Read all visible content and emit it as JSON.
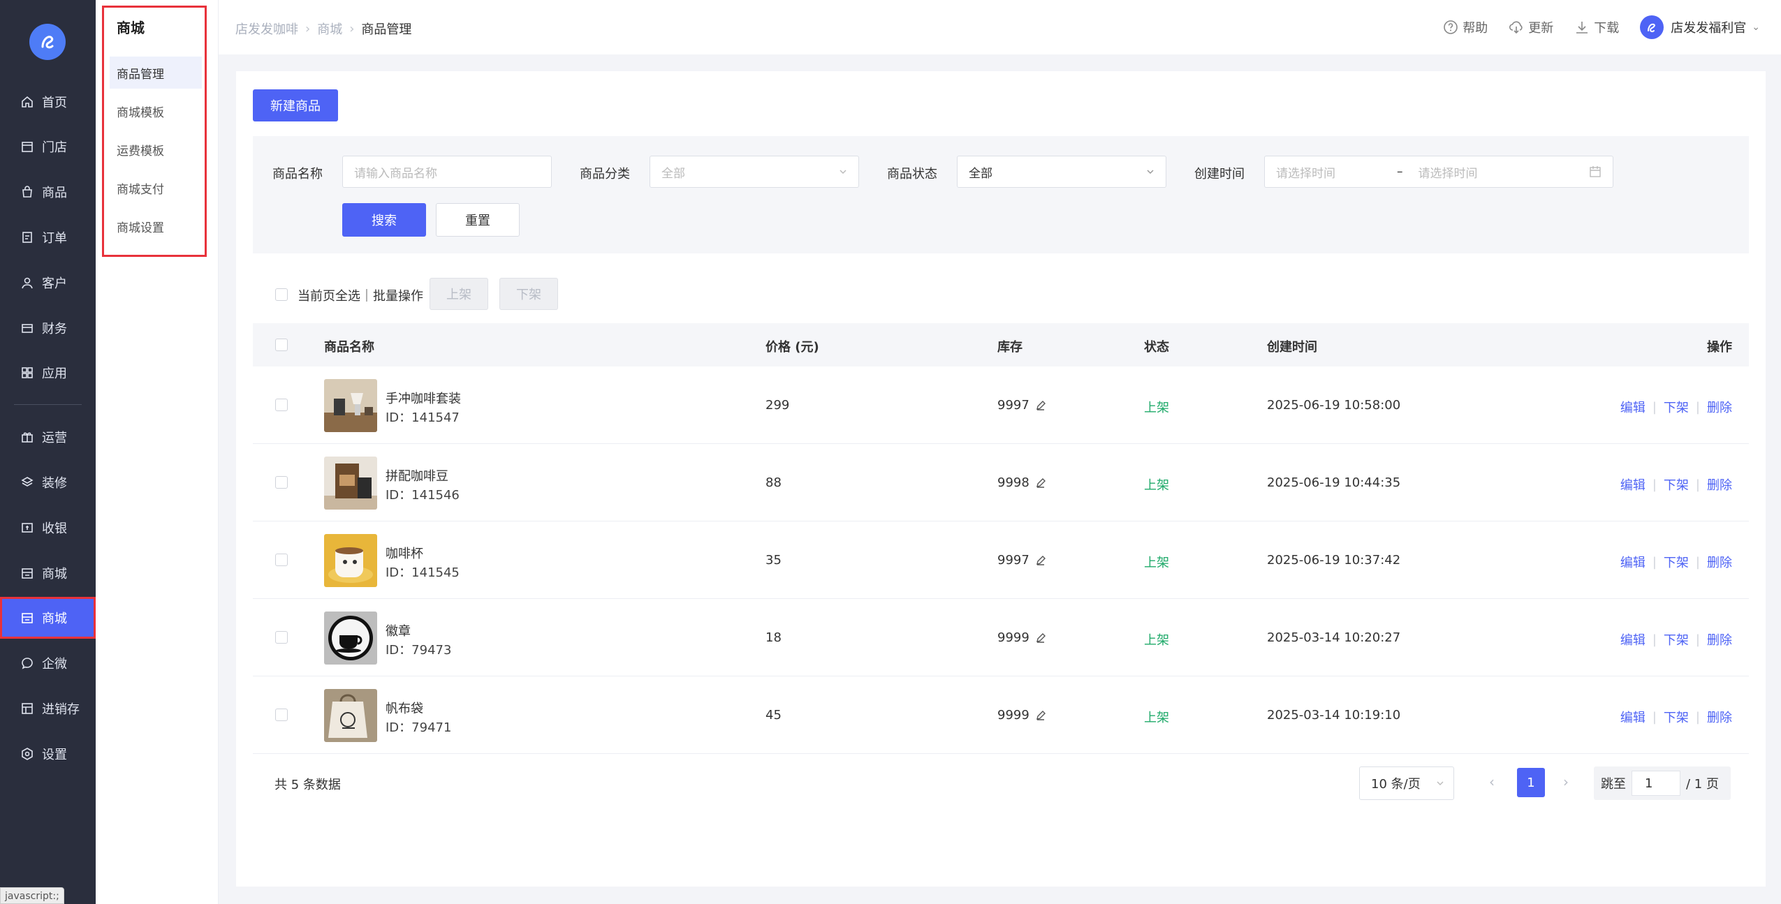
{
  "sidebar": {
    "items": [
      {
        "label": "首页",
        "icon": "home-icon"
      },
      {
        "label": "门店",
        "icon": "store-icon"
      },
      {
        "label": "商品",
        "icon": "bag-icon"
      },
      {
        "label": "订单",
        "icon": "order-icon"
      },
      {
        "label": "客户",
        "icon": "user-icon"
      },
      {
        "label": "财务",
        "icon": "wallet-icon"
      },
      {
        "label": "应用",
        "icon": "apps-icon"
      },
      {
        "label": "运营",
        "icon": "gift-icon"
      },
      {
        "label": "装修",
        "icon": "layers-icon"
      },
      {
        "label": "收银",
        "icon": "cashier-icon"
      },
      {
        "label": "商城",
        "icon": "shop-icon"
      },
      {
        "label": "商城",
        "icon": "shop-icon"
      },
      {
        "label": "企微",
        "icon": "chat-icon"
      },
      {
        "label": "进销存",
        "icon": "inventory-icon"
      },
      {
        "label": "设置",
        "icon": "gear-icon"
      }
    ],
    "active_index": 11,
    "status_hint": "javascript:;"
  },
  "submenu": {
    "title": "商城",
    "items": [
      "商品管理",
      "商城模板",
      "运费模板",
      "商城支付",
      "商城设置"
    ],
    "active_index": 0
  },
  "header": {
    "breadcrumb": [
      "店发发咖啡",
      "商城",
      "商品管理"
    ],
    "help": "帮助",
    "update": "更新",
    "download": "下载",
    "user": "店发发福利官"
  },
  "toolbar": {
    "new_product": "新建商品"
  },
  "filters": {
    "name_label": "商品名称",
    "name_placeholder": "请输入商品名称",
    "category_label": "商品分类",
    "category_value": "全部",
    "status_label": "商品状态",
    "status_value": "全部",
    "time_label": "创建时间",
    "time_start_placeholder": "请选择时间",
    "time_sep": "–",
    "time_end_placeholder": "请选择时间",
    "search": "搜索",
    "reset": "重置"
  },
  "batch": {
    "select_all": "当前页全选｜批量操作",
    "on_shelf": "上架",
    "off_shelf": "下架"
  },
  "table": {
    "headers": {
      "name": "商品名称",
      "price": "价格 (元)",
      "stock": "库存",
      "status": "状态",
      "created": "创建时间",
      "ops": "操作"
    },
    "rows": [
      {
        "name": "手冲咖啡套装",
        "id": "ID：141547",
        "price": "299",
        "stock": "9997",
        "status": "上架",
        "created": "2025-06-19 10:58:00"
      },
      {
        "name": "拼配咖啡豆",
        "id": "ID：141546",
        "price": "88",
        "stock": "9998",
        "status": "上架",
        "created": "2025-06-19 10:44:35"
      },
      {
        "name": "咖啡杯",
        "id": "ID：141545",
        "price": "35",
        "stock": "9997",
        "status": "上架",
        "created": "2025-06-19 10:37:42"
      },
      {
        "name": "徽章",
        "id": "ID：79473",
        "price": "18",
        "stock": "9999",
        "status": "上架",
        "created": "2025-03-14 10:20:27"
      },
      {
        "name": "帆布袋",
        "id": "ID：79471",
        "price": "45",
        "stock": "9999",
        "status": "上架",
        "created": "2025-03-14 10:19:10"
      }
    ],
    "op_edit": "编辑",
    "op_off": "下架",
    "op_delete": "删除"
  },
  "pagination": {
    "total": "共 5 条数据",
    "page_size": "10 条/页",
    "current": "1",
    "jump_label": "跳至",
    "jump_value": "1",
    "jump_suffix": "/ 1 页"
  },
  "colors": {
    "primary": "#4e63f5",
    "sidebar": "#2a2e3d",
    "status_on": "#1faa6a",
    "highlight": "#e8323b"
  }
}
